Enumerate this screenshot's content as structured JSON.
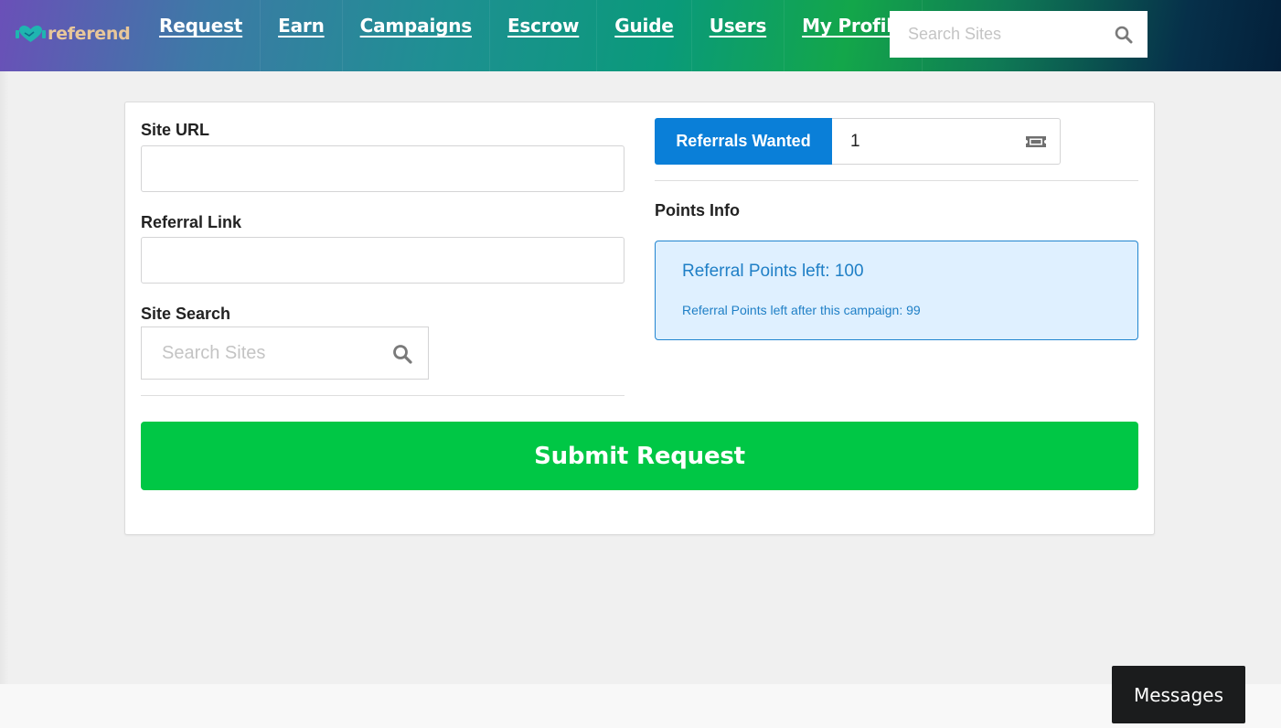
{
  "brand": {
    "name": "referend",
    "accent": "#e8c79a"
  },
  "nav": {
    "items": [
      {
        "label": "Request"
      },
      {
        "label": "Earn"
      },
      {
        "label": "Campaigns"
      },
      {
        "label": "Escrow"
      },
      {
        "label": "Guide"
      },
      {
        "label": "Users"
      },
      {
        "label": "My Profile"
      }
    ],
    "search": {
      "placeholder": "Search Sites",
      "icon": "search-icon"
    }
  },
  "form": {
    "site_url": {
      "label": "Site URL",
      "value": ""
    },
    "referral_link": {
      "label": "Referral Link",
      "value": ""
    },
    "site_search": {
      "label": "Site Search",
      "placeholder": "Search Sites",
      "icon": "search-icon"
    },
    "referrals_wanted": {
      "label": "Referrals Wanted",
      "value": "1",
      "icon": "ticket-icon",
      "color": "#0a7fd8"
    },
    "points_info": {
      "label": "Points Info",
      "header": "Referral Points left: 100",
      "sub": "Referral Points left after this campaign: 99"
    },
    "submit": {
      "label": "Submit Request",
      "color": "#00c745"
    }
  },
  "messages": {
    "label": "Messages"
  }
}
